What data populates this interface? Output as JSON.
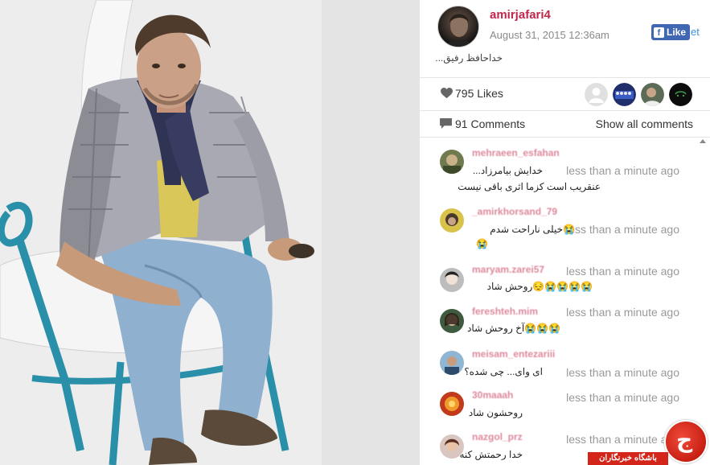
{
  "post": {
    "username": "amirjafari4",
    "date": "August 31, 2015 12:36am",
    "caption": "خداحافظ رفیق...",
    "like_button_label": "Like",
    "tweet_fragment": "et"
  },
  "stats": {
    "likes_label": "795 Likes",
    "comments_label": "91 Comments",
    "show_all_label": "Show all comments"
  },
  "likers": [
    "default-avatar",
    "team-avatar",
    "portrait-avatar",
    "dark-avatar"
  ],
  "comments": [
    {
      "user": "mehraeen_esfahan",
      "time": "less than a minute ago",
      "text_1": "خدایش بیامرزاد...",
      "text_2": "عنقریب است کزما اثری باقی نیست"
    },
    {
      "user": "_amirkhorsand_79",
      "time": "less than a minute ago",
      "text_1": "😭خیلی ناراحت شدم",
      "text_2": "😭"
    },
    {
      "user": "maryam.zarei57",
      "time": "less than a minute ago",
      "text_1": "😭😭😭😭😔روحش شاد"
    },
    {
      "user": "fereshteh.mim",
      "time": "less than a minute ago",
      "text_1": "😭😭😭آخ روحش شاد"
    },
    {
      "user": "meisam_entezariii",
      "time": "less than a minute ago",
      "text_1": "ای وای... چی شده؟"
    },
    {
      "user": "30maaah",
      "time": "less than a minute ago",
      "text_1": "روحشون شاد"
    },
    {
      "user": "nazgol_prz",
      "time": "less than a minute ago",
      "text_1": "خدا رحمتش کنه"
    }
  ],
  "watermark": {
    "label": "باشگاه خبرنگاران",
    "glyph": "ج"
  },
  "colors": {
    "username": "#c1274a",
    "facebook": "#4267b2",
    "watermark": "#d3251a"
  }
}
